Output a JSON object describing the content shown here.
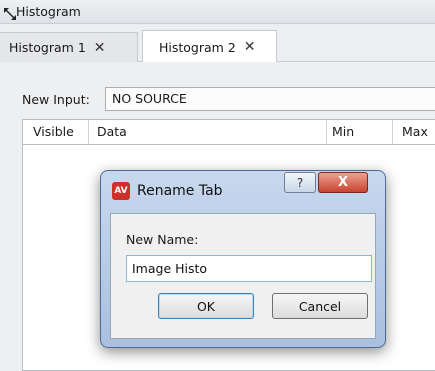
{
  "window": {
    "title": "Histogram",
    "resize_icon": "resize-arrows-icon"
  },
  "tabs": [
    {
      "label": "Histogram 1",
      "close_icon": "close-x-icon",
      "active": false
    },
    {
      "label": "Histogram 2",
      "close_icon": "close-x-icon",
      "active": true
    }
  ],
  "input": {
    "label": "New Input:",
    "value": "NO SOURCE"
  },
  "table": {
    "columns": [
      "Visible",
      "Data",
      "Min",
      "Max"
    ]
  },
  "dialog": {
    "title": "Rename Tab",
    "logo_text": "AV",
    "help_label": "?",
    "close_label": "X",
    "field_label": "New Name:",
    "field_value": "Image Histo",
    "ok_label": "OK",
    "cancel_label": "Cancel"
  },
  "colors": {
    "accent": "#3c7fb1",
    "close": "#c8442f",
    "logo": "#d0302a"
  }
}
